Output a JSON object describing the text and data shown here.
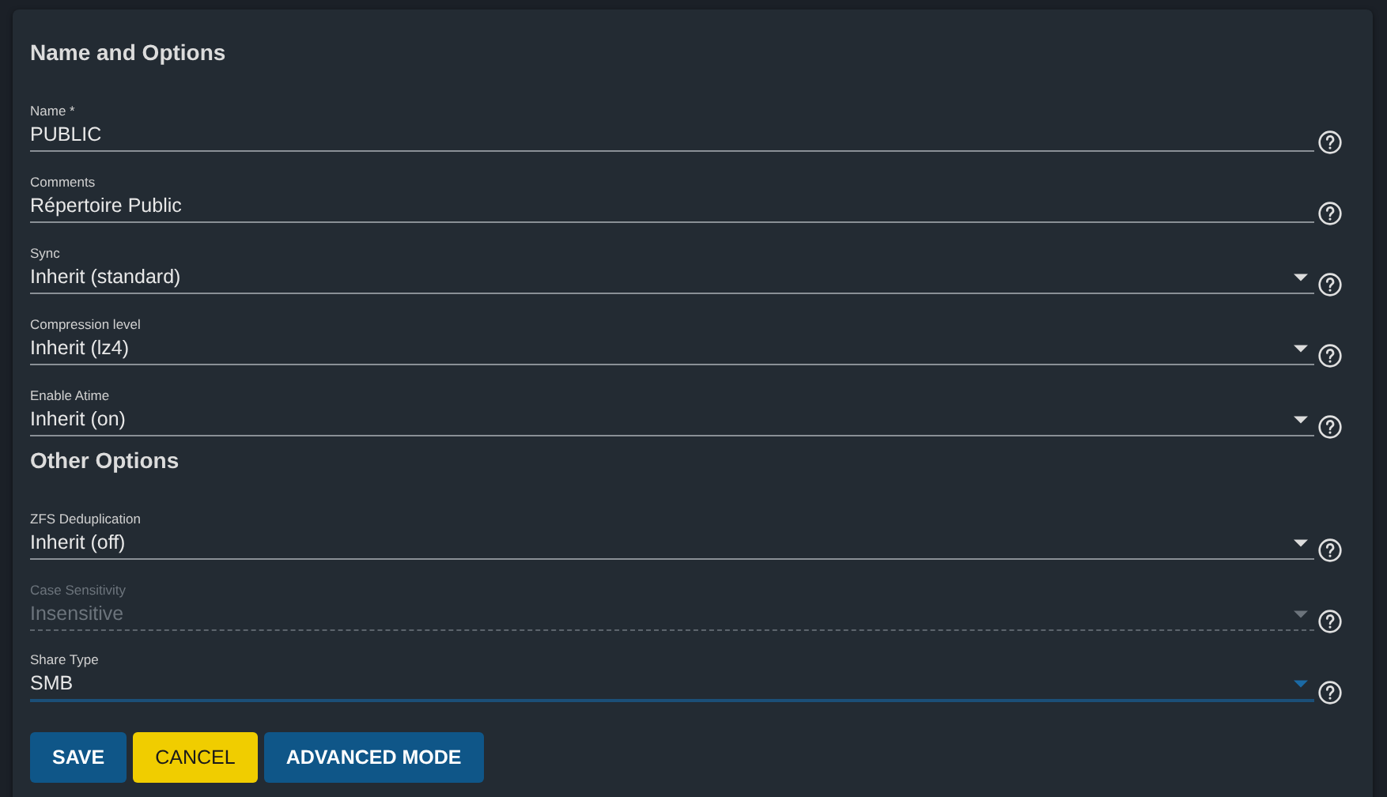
{
  "sections": [
    {
      "title": "Name and Options",
      "fields": [
        {
          "kind": "input",
          "label": "Name *",
          "value": "PUBLIC",
          "disabled": false,
          "focused": false
        },
        {
          "kind": "input",
          "label": "Comments",
          "value": "Répertoire Public",
          "disabled": false,
          "focused": false
        },
        {
          "kind": "select",
          "label": "Sync",
          "value": "Inherit (standard)",
          "disabled": false,
          "focused": false
        },
        {
          "kind": "select",
          "label": "Compression level",
          "value": "Inherit (lz4)",
          "disabled": false,
          "focused": false
        },
        {
          "kind": "select",
          "label": "Enable Atime",
          "value": "Inherit (on)",
          "disabled": false,
          "focused": false
        }
      ]
    },
    {
      "title": "Other Options",
      "fields": [
        {
          "kind": "select",
          "label": "ZFS Deduplication",
          "value": "Inherit (off)",
          "disabled": false,
          "focused": false
        },
        {
          "kind": "select",
          "label": "Case Sensitivity",
          "value": "Insensitive",
          "disabled": true,
          "focused": false
        },
        {
          "kind": "select",
          "label": "Share Type",
          "value": "SMB",
          "disabled": false,
          "focused": true
        }
      ]
    }
  ],
  "buttons": [
    {
      "label": "SAVE",
      "kind": "primary"
    },
    {
      "label": "CANCEL",
      "kind": "warning"
    },
    {
      "label": "ADVANCED MODE",
      "kind": "primary"
    }
  ]
}
